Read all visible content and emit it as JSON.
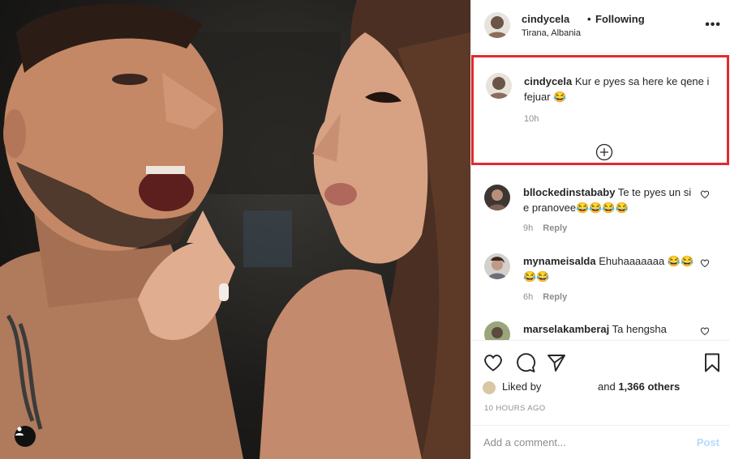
{
  "header": {
    "username": "cindycela",
    "separator": "•",
    "follow_status": "Following",
    "location": "Tirana, Albania",
    "more_glyph": "•••"
  },
  "caption": {
    "username": "cindycela",
    "text": "Kur e pyes sa here ke qene i fejuar 😂",
    "time": "10h"
  },
  "comments": [
    {
      "username": "bllockedinstababy",
      "text": "Te te pyes un si e pranovee😂😂😂😂",
      "time": "9h",
      "reply_label": "Reply"
    },
    {
      "username": "mynameisalda",
      "text": "Ehuhaaaaaaa 😂😂😂😂",
      "time": "6h",
      "reply_label": "Reply"
    },
    {
      "username": "marselakamberaj",
      "text": "Ta hengsha",
      "time": "",
      "reply_label": ""
    }
  ],
  "likes": {
    "prefix": "Liked by",
    "suffix_prefix": "and",
    "count": "1,366 others"
  },
  "timestamp": "10 HOURS AGO",
  "add_comment": {
    "placeholder": "Add a comment...",
    "post_label": "Post"
  },
  "colors": {
    "highlight_border": "#e32a2f",
    "post_button": "#b3dbff",
    "secondary_text": "#8e8e8e"
  },
  "icons": [
    "heart-icon",
    "comment-icon",
    "share-icon",
    "bookmark-icon",
    "tag-person-icon",
    "load-more-icon"
  ]
}
